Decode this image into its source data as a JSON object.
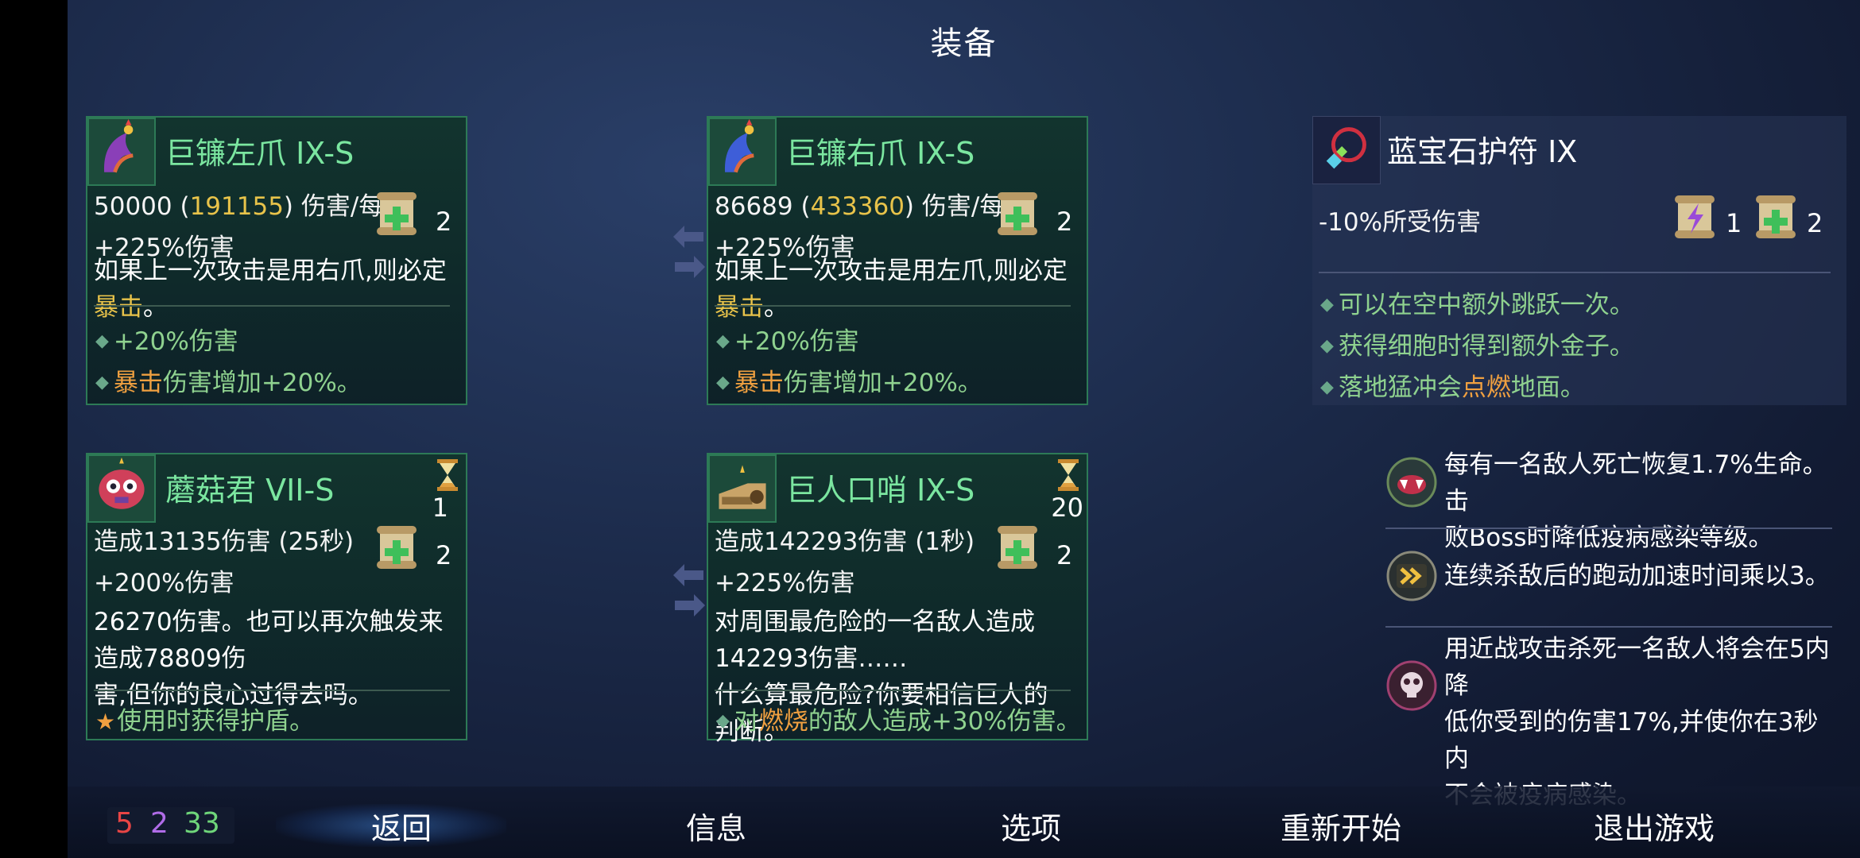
{
  "title": "装备",
  "cards": {
    "left_claw": {
      "name": "巨镰左爪 IX-S",
      "dps_value": "50000",
      "dps_crit": "191155",
      "dps_unit": "伤害/每秒",
      "bonus": "+225%伤害",
      "scroll_count": "2",
      "desc_a": "如果上一次攻击是用右爪,则必定",
      "desc_hl": "暴击",
      "desc_b": "。",
      "bullet1": "+20%伤害",
      "bullet2_hl": "暴击",
      "bullet2": "伤害增加+20%。"
    },
    "right_claw": {
      "name": "巨镰右爪 IX-S",
      "dps_value": "86689",
      "dps_crit": "433360",
      "dps_unit": "伤害/每秒",
      "bonus": "+225%伤害",
      "scroll_count": "2",
      "desc_a": "如果上一次攻击是用左爪,则必定",
      "desc_hl": "暴击",
      "desc_b": "。",
      "bullet1": "+20%伤害",
      "bullet2_hl": "暴击",
      "bullet2": "伤害增加+20%。"
    },
    "amulet": {
      "name": "蓝宝石护符 IX",
      "stat": "-10%所受伤害",
      "scroll_purple_count": "1",
      "scroll_green_count": "2",
      "bullet1": "可以在空中额外跳跃一次。",
      "bullet2": "获得细胞时得到额外金子。",
      "bullet3_a": "落地猛冲会",
      "bullet3_hl": "点燃",
      "bullet3_b": "地面。"
    },
    "mushroom": {
      "name": "蘑菇君 VII-S",
      "cooldown": "1",
      "line1": "造成13135伤害 (25秒)",
      "bonus": "+200%伤害",
      "scroll_count": "2",
      "desc1": "26270伤害。也可以再次触发来造成78809伤",
      "desc2": "害,但你的良心过得去吗。",
      "bullet1": "使用时获得护盾。"
    },
    "whistle": {
      "name": "巨人口哨 IX-S",
      "cooldown": "20",
      "line1": "造成142293伤害 (1秒)",
      "bonus": "+225%伤害",
      "scroll_count": "2",
      "desc1": "对周围最危险的一名敌人造成142293伤害……",
      "desc2": "什么算最危险?你要相信巨人的判断。",
      "bullet1_a": "对",
      "bullet1_hl": "燃烧",
      "bullet1_b": "的敌人造成+30%伤害。"
    }
  },
  "mutations": [
    {
      "icon": "vampire-mouth-icon",
      "line1": "每有一名敌人死亡恢复1.7%生命。击",
      "line2": "败Boss时降低疫病感染等级。"
    },
    {
      "icon": "speed-arrows-icon",
      "line1": "连续杀敌后的跑动加速时间乘以3。"
    },
    {
      "icon": "skull-icon",
      "line1": "用近战攻击杀死一名敌人将会在5内降",
      "line2": "低你受到的伤害17%,并使你在3秒内",
      "line3": "不会被疫病感染。"
    }
  ],
  "stats": {
    "red": "5",
    "purple": "2",
    "green": "33"
  },
  "menu": {
    "back": "返回",
    "info": "信息",
    "options": "选项",
    "restart": "重新开始",
    "quit": "退出游戏"
  },
  "colors": {
    "accent_green": "#7be6a0",
    "gold": "#e8c34a",
    "orange": "#f0a040",
    "red": "#e84545",
    "purple": "#b06ce8",
    "stat_green": "#6fd67a"
  }
}
